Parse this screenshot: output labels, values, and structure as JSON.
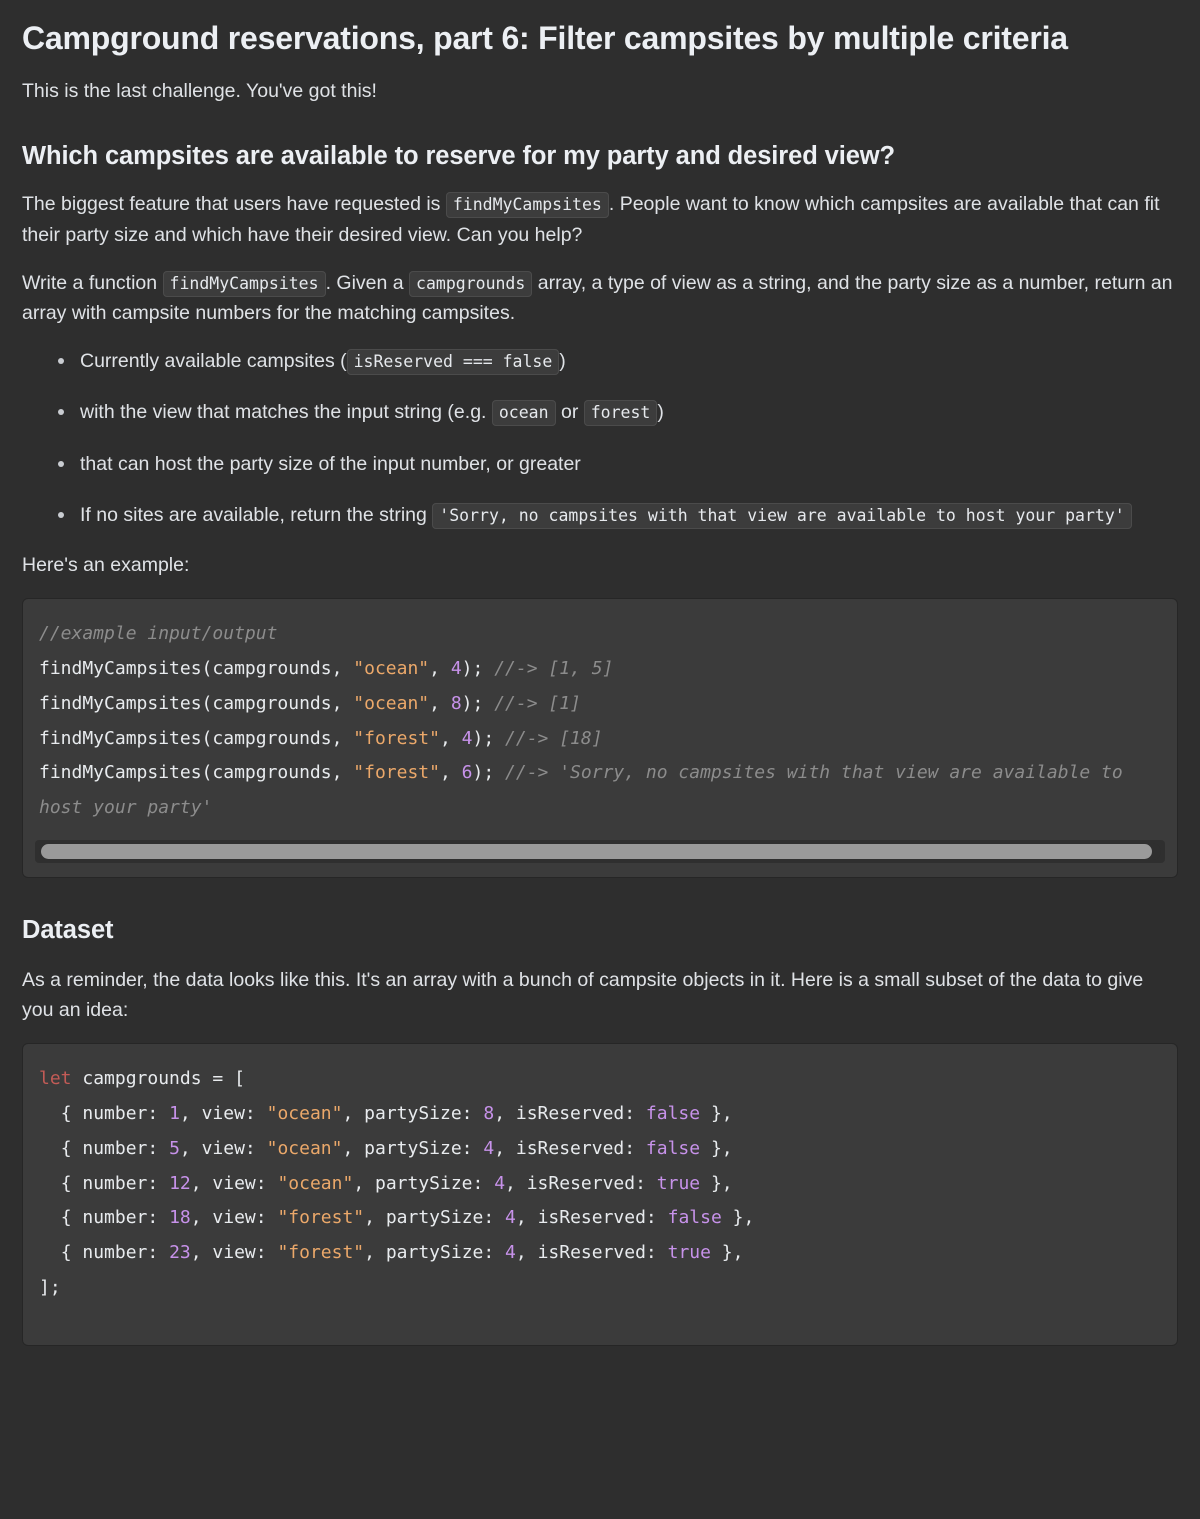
{
  "doc": {
    "title": "Campground reservations, part 6: Filter campsites by multiple criteria",
    "subtitle": "This is the last challenge. You've got this!",
    "section_heading": "Which campsites are available to reserve for my party and desired view?",
    "paragraph_1_part_1": "The biggest feature that users have requested is",
    "paragraph_1_code": "findMyCampsites",
    "paragraph_1_part_2": ". People want to know which campsites are available that can fit their party size and which have their desired view. Can you help?",
    "paragraph_2_part_1": "Write a function",
    "paragraph_2_code_1": "findMyCampsites",
    "paragraph_2_part_2": ". Given a",
    "paragraph_2_code_2": "campgrounds",
    "paragraph_2_part_3": "array, a type of view as a string, and the party size as a number, return an array with campsite numbers for the matching campsites.",
    "example_lead": "Here's an example:",
    "dataset_heading": "Dataset",
    "dataset_paragraph": "As a reminder, the data looks like this. It's an array with a bunch of campsite objects in it. Here is a small subset of the data to give you an idea:"
  },
  "criteria": {
    "item1_part1": "Currently available campsites (",
    "item1_code": "isReserved === false",
    "item1_part2": ")",
    "item2_part1": "with the view that matches the input string (e.g.",
    "item2_code_1": "ocean",
    "item2_part2": "or",
    "item2_code_2": "forest",
    "item2_part3": ")",
    "item3": "that can host the party size of the input number, or greater",
    "item4_part1": "If no sites are available, return the string",
    "item4_code": "'Sorry, no campsites with that view are available to host your party'"
  },
  "example_code": {
    "comment_header": "//example input/output",
    "lines": [
      {
        "call": "findMyCampsites(campgrounds, ",
        "string": "\"ocean\"",
        "mid": ", ",
        "number": "4",
        "close": "); ",
        "comment": "//-> [1, 5]"
      },
      {
        "call": "findMyCampsites(campgrounds, ",
        "string": "\"ocean\"",
        "mid": ", ",
        "number": "8",
        "close": "); ",
        "comment": "//-> [1]"
      },
      {
        "call": "findMyCampsites(campgrounds, ",
        "string": "\"forest\"",
        "mid": ", ",
        "number": "4",
        "close": "); ",
        "comment": "//-> [18]"
      },
      {
        "call": "findMyCampsites(campgrounds, ",
        "string": "\"forest\"",
        "mid": ", ",
        "number": "6",
        "close": "); ",
        "comment": "//-> 'Sorry, no campsites with that view are available to host your party'"
      }
    ]
  },
  "dataset_code": {
    "keyword": "let",
    "declaration": " campgrounds = [",
    "closing": "];",
    "rows": [
      {
        "number": "1",
        "view": "\"ocean\"",
        "partySize": "8",
        "isReserved": "false"
      },
      {
        "number": "5",
        "view": "\"ocean\"",
        "partySize": "4",
        "isReserved": "false"
      },
      {
        "number": "12",
        "view": "\"ocean\"",
        "partySize": "4",
        "isReserved": "true"
      },
      {
        "number": "18",
        "view": "\"forest\"",
        "partySize": "4",
        "isReserved": "false"
      },
      {
        "number": "23",
        "view": "\"forest\"",
        "partySize": "4",
        "isReserved": "true"
      }
    ],
    "labels": {
      "open_brace": "{ number: ",
      "view_label": ", view: ",
      "party_label": ", partySize: ",
      "reserved_label": ", isReserved: ",
      "close_brace": " },"
    }
  },
  "scrollbar": {
    "orientation": "horizontal",
    "thumb_color": "#9a9a9a"
  },
  "colors": {
    "page_background": "#2e2e2e",
    "code_background": "#3b3b3b",
    "text": "#dfe2e6",
    "heading": "#eceff3",
    "string": "#eba86a",
    "number": "#c792ea",
    "keyword": "#c25b56",
    "comment": "#8c8c8c"
  }
}
